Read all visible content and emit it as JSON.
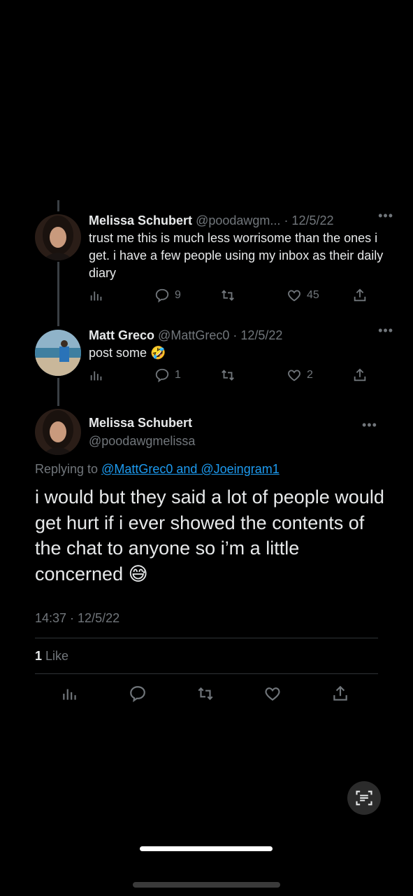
{
  "thread": [
    {
      "name": "Melissa Schubert",
      "handle": "@poodawgm...",
      "date": "· 12/5/22",
      "more": "•••",
      "text": "trust me this is much less worrisome than the ones i get. i have a few people using my inbox as their daily diary",
      "replies": "9",
      "retweets": "",
      "likes": "45"
    },
    {
      "name": "Matt Greco",
      "handle": "@MattGrec0",
      "date": "· 12/5/22",
      "more": "•••",
      "text": "post some 🤣",
      "replies": "1",
      "retweets": "",
      "likes": "2"
    }
  ],
  "main": {
    "name": "Melissa Schubert",
    "handle": "@poodawgmelissa",
    "more": "•••",
    "replying_prefix": "Replying to ",
    "replying_to": "@MattGrec0 and @Joeingram1",
    "text": "i would but they said a lot of people would get hurt if i ever showed the contents of the chat to anyone so i’m a little concerned 😅",
    "timestamp": "14:37 · 12/5/22",
    "like_count": "1",
    "like_label": " Like"
  },
  "icons": [
    "views-icon",
    "reply-icon",
    "retweet-icon",
    "like-icon",
    "share-icon",
    "scan-text-icon"
  ],
  "colors": {
    "background": "#000000",
    "text": "#e7e9ea",
    "muted": "#71767b",
    "link": "#1d9bf0",
    "divider": "#2f3336"
  }
}
